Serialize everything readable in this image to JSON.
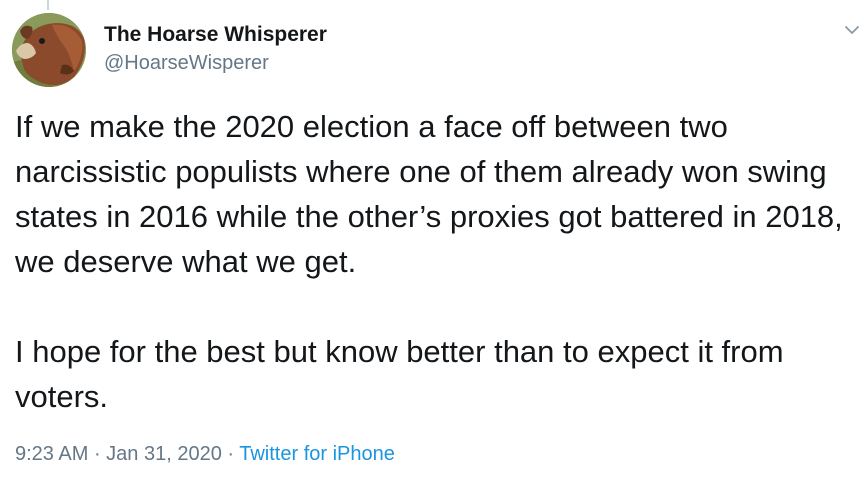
{
  "author": {
    "display_name": "The Hoarse Whisperer",
    "handle": "@HoarseWisperer",
    "avatar_icon": "horse-avatar"
  },
  "tweet": {
    "paragraphs": [
      "If we make the 2020 election a face off between two narcissistic populists where one of them already won swing states in 2016 while the other’s proxies got battered in 2018, we deserve what we get.",
      "I hope for the best but know better than to expect it from voters."
    ]
  },
  "meta": {
    "time": "9:23 AM",
    "separator": " · ",
    "date": "Jan 31, 2020",
    "source": "Twitter for iPhone"
  },
  "menu": {
    "icon": "chevron-down-icon"
  },
  "colors": {
    "text": "#14171a",
    "secondary": "#657786",
    "link": "#1b95e0",
    "caret": "#8899a6"
  }
}
